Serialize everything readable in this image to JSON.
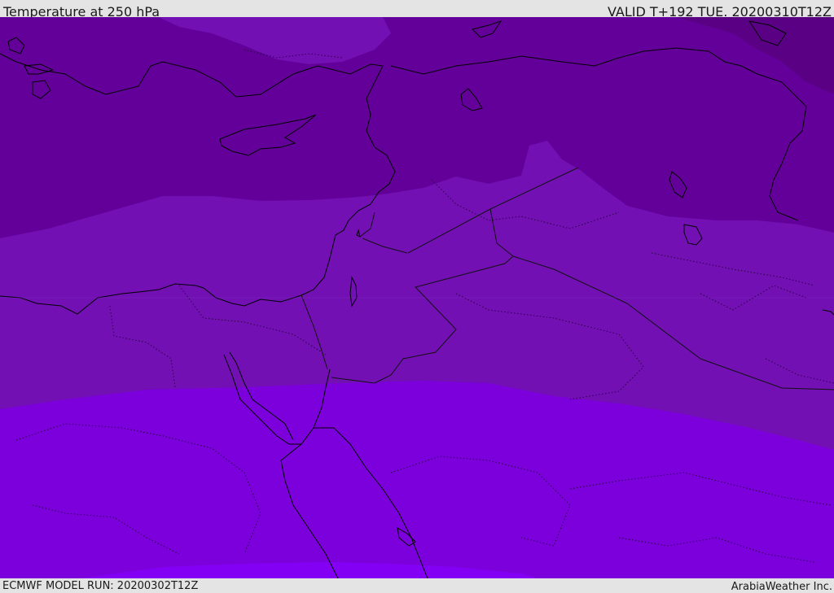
{
  "header": {
    "title": "Temperature at 250 hPa",
    "valid": "VALID T+192 TUE. 20200310T12Z"
  },
  "footer": {
    "model_run": "ECMWF MODEL RUN: 20200302T12Z",
    "credit": "ArabiaWeather Inc."
  },
  "map": {
    "variable": "Temperature",
    "level": "250 hPa",
    "colors": {
      "band_coldest": "#5a0084",
      "band_cold": "#64009a",
      "band_mid": "#7210b4",
      "band_warm": "#7c00dc",
      "band_warmest": "#8400f4",
      "coastline": "#000000",
      "border": "#1a1a1a"
    }
  }
}
